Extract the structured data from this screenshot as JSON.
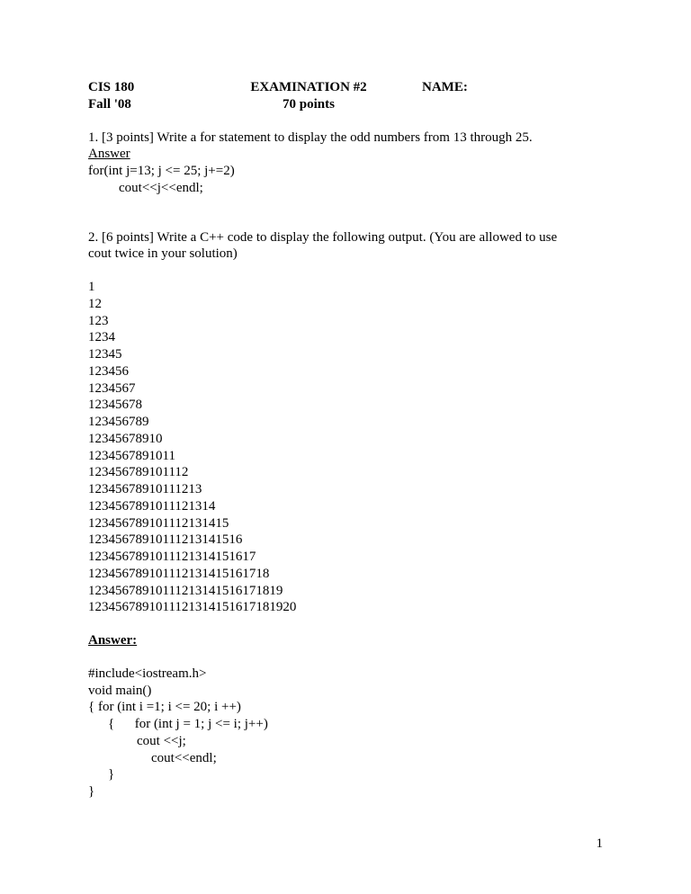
{
  "header": {
    "course": "CIS 180",
    "term": "Fall '08",
    "title": "EXAMINATION #2",
    "points": "70 points",
    "name_label": "NAME:"
  },
  "q1": {
    "prompt": "1. [3 points]  Write a for statement to display the odd numbers from 13 through 25.",
    "answer_label": "Answer",
    "code1": "for(int j=13; j <= 25; j+=2)",
    "code2": "cout<<j<<endl;"
  },
  "q2": {
    "prompt1": "2. [6 points] Write a C++ code to display the following output. (You are allowed to use",
    "prompt2": "cout twice in your solution)",
    "output": [
      "1",
      "12",
      "123",
      "1234",
      "12345",
      "123456",
      "1234567",
      "12345678",
      "123456789",
      "12345678910",
      "1234567891011",
      "123456789101112",
      "12345678910111213",
      "1234567891011121314",
      "123456789101112131415",
      "12345678910111213141516",
      "1234567891011121314151617",
      "123456789101112131415161718",
      "12345678910111213141516171819",
      "1234567891011121314151617181920"
    ],
    "answer_label": "Answer:",
    "code1": "#include<iostream.h>",
    "code2": "void main()",
    "code3": "{ for (int i =1; i <= 20; i ++)",
    "code4": "{      for (int j = 1; j <= i; j++)",
    "code5": "cout <<j;",
    "code6": "cout<<endl;",
    "code7": "}",
    "code8": "}"
  },
  "page_number": "1"
}
